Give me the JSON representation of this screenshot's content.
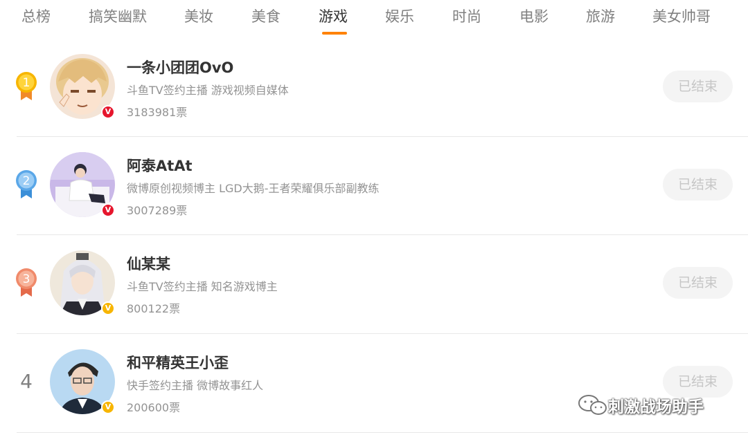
{
  "tabs": [
    {
      "label": "总榜"
    },
    {
      "label": "搞笑幽默"
    },
    {
      "label": "美妆"
    },
    {
      "label": "美食"
    },
    {
      "label": "游戏"
    },
    {
      "label": "娱乐"
    },
    {
      "label": "时尚"
    },
    {
      "label": "电影"
    },
    {
      "label": "旅游"
    },
    {
      "label": "美女帅哥"
    }
  ],
  "active_tab": "游戏",
  "colors": {
    "accent": "#ff8200",
    "rank1": "#f7b500",
    "rank2": "#5aa7e8",
    "rank3": "#f08a6a",
    "badge_red": "#e6162d",
    "badge_gold": "#f7b500"
  },
  "list": [
    {
      "rank": "1",
      "name": "一条小团团OvO",
      "desc": "斗鱼TV签约主播 游戏视频自媒体",
      "votes": "3183981票",
      "status": "已结束",
      "badge": "v-red-icon"
    },
    {
      "rank": "2",
      "name": "阿泰AtAt",
      "desc": "微博原创视频博主 LGD大鹅-王者荣耀俱乐部副教练",
      "votes": "3007289票",
      "status": "已结束",
      "badge": "v-red-icon"
    },
    {
      "rank": "3",
      "name": "仙某某",
      "desc": "斗鱼TV签约主播 知名游戏博主",
      "votes": "800122票",
      "status": "已结束",
      "badge": "v-gold-icon"
    },
    {
      "rank": "4",
      "name": "和平精英王小歪",
      "desc": "快手签约主播 微博故事红人",
      "votes": "200600票",
      "status": "已结束",
      "badge": "v-gold-icon"
    }
  ],
  "watermark": "刺激战场助手"
}
